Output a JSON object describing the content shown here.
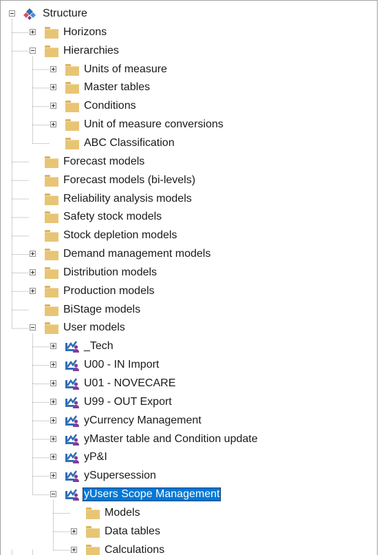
{
  "tree": {
    "root": {
      "label": "Structure",
      "icon": "structure-icon"
    },
    "items": [
      {
        "label": "Horizons",
        "level": 1,
        "icon": "folder-icon",
        "expander": "plus"
      },
      {
        "label": "Hierarchies",
        "level": 1,
        "icon": "folder-icon",
        "expander": "minus"
      },
      {
        "label": "Units of measure",
        "level": 2,
        "icon": "folder-icon",
        "expander": "plus"
      },
      {
        "label": "Master tables",
        "level": 2,
        "icon": "folder-icon",
        "expander": "plus"
      },
      {
        "label": "Conditions",
        "level": 2,
        "icon": "folder-icon",
        "expander": "plus"
      },
      {
        "label": "Unit of measure conversions",
        "level": 2,
        "icon": "folder-icon",
        "expander": "plus"
      },
      {
        "label": "ABC Classification",
        "level": 2,
        "icon": "folder-icon",
        "expander": "none"
      },
      {
        "label": "Forecast models",
        "level": 1,
        "icon": "folder-icon",
        "expander": "none"
      },
      {
        "label": "Forecast models (bi-levels)",
        "level": 1,
        "icon": "folder-icon",
        "expander": "none"
      },
      {
        "label": "Reliability analysis models",
        "level": 1,
        "icon": "folder-icon",
        "expander": "none"
      },
      {
        "label": "Safety stock models",
        "level": 1,
        "icon": "folder-icon",
        "expander": "none"
      },
      {
        "label": "Stock depletion models",
        "level": 1,
        "icon": "folder-icon",
        "expander": "none"
      },
      {
        "label": "Demand management models",
        "level": 1,
        "icon": "folder-icon",
        "expander": "plus"
      },
      {
        "label": "Distribution models",
        "level": 1,
        "icon": "folder-icon",
        "expander": "plus"
      },
      {
        "label": "Production models",
        "level": 1,
        "icon": "folder-icon",
        "expander": "plus"
      },
      {
        "label": "BiStage models",
        "level": 1,
        "icon": "folder-icon",
        "expander": "none"
      },
      {
        "label": "User models",
        "level": 1,
        "icon": "folder-icon",
        "expander": "minus"
      },
      {
        "label": "_Tech",
        "level": 2,
        "icon": "user-model-icon",
        "expander": "plus"
      },
      {
        "label": "U00 - IN Import",
        "level": 2,
        "icon": "user-model-icon",
        "expander": "plus"
      },
      {
        "label": "U01 - NOVECARE",
        "level": 2,
        "icon": "user-model-icon",
        "expander": "plus"
      },
      {
        "label": "U99 - OUT Export",
        "level": 2,
        "icon": "user-model-icon",
        "expander": "plus"
      },
      {
        "label": "yCurrency Management",
        "level": 2,
        "icon": "user-model-icon",
        "expander": "plus"
      },
      {
        "label": "yMaster table and Condition update",
        "level": 2,
        "icon": "user-model-icon",
        "expander": "plus"
      },
      {
        "label": "yP&I",
        "level": 2,
        "icon": "user-model-icon",
        "expander": "plus"
      },
      {
        "label": "ySupersession",
        "level": 2,
        "icon": "user-model-icon",
        "expander": "plus"
      },
      {
        "label": "yUsers Scope Management",
        "level": 2,
        "icon": "user-model-icon",
        "expander": "minus",
        "selected": true
      },
      {
        "label": "Models",
        "level": 3,
        "icon": "folder-icon",
        "expander": "none"
      },
      {
        "label": "Data tables",
        "level": 3,
        "icon": "folder-icon",
        "expander": "plus"
      },
      {
        "label": "Calculations",
        "level": 3,
        "icon": "folder-icon",
        "expander": "plus"
      }
    ]
  },
  "colors": {
    "selection": "#0078d7",
    "folder": "#e8c574",
    "model_icon_blue": "#2e6fb8",
    "model_icon_purple": "#7b3f99"
  }
}
